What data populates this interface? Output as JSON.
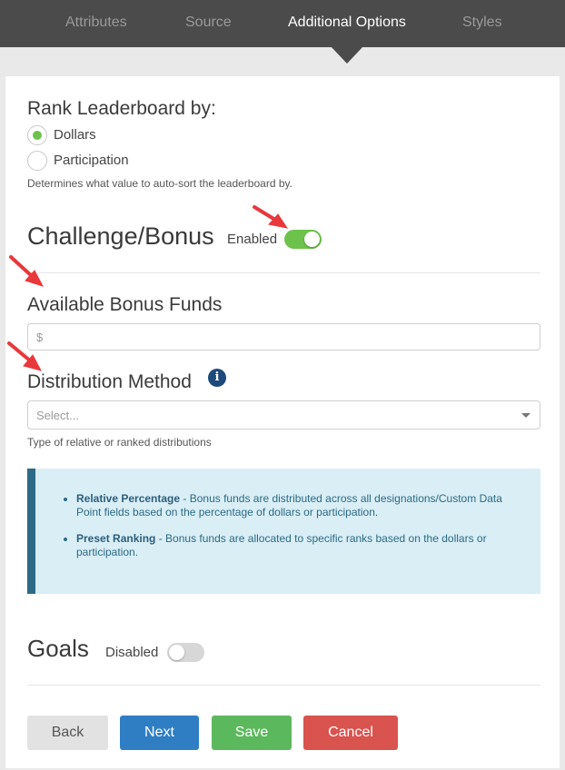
{
  "tabs": [
    {
      "label": "Attributes",
      "active": false
    },
    {
      "label": "Source",
      "active": false
    },
    {
      "label": "Additional Options",
      "active": true
    },
    {
      "label": "Styles",
      "active": false
    }
  ],
  "rank": {
    "title": "Rank Leaderboard by:",
    "options": [
      {
        "label": "Dollars",
        "checked": true
      },
      {
        "label": "Participation",
        "checked": false
      }
    ],
    "help": "Determines what value to auto-sort the leaderboard by."
  },
  "challenge": {
    "title": "Challenge/Bonus",
    "toggle_label": "Enabled",
    "enabled": true
  },
  "bonus_funds": {
    "label": "Available Bonus Funds",
    "placeholder": "$"
  },
  "distribution": {
    "label": "Distribution Method",
    "select_placeholder": "Select...",
    "help": "Type of relative or ranked distributions"
  },
  "callout": {
    "items": [
      {
        "term": "Relative Percentage",
        "text": " - Bonus funds are distributed across all designations/Custom Data Point fields based on the percentage of dollars or participation."
      },
      {
        "term": "Preset Ranking",
        "text": " - Bonus funds are allocated to specific ranks based on the dollars or participation."
      }
    ]
  },
  "goals": {
    "title": "Goals",
    "toggle_label": "Disabled",
    "enabled": false
  },
  "buttons": {
    "back": "Back",
    "next": "Next",
    "save": "Save",
    "cancel": "Cancel"
  },
  "colors": {
    "accent_green": "#6cc24a",
    "primary_blue": "#2f7ec4",
    "annotation_red": "#e8383c",
    "callout_bg": "#d9eef5"
  }
}
